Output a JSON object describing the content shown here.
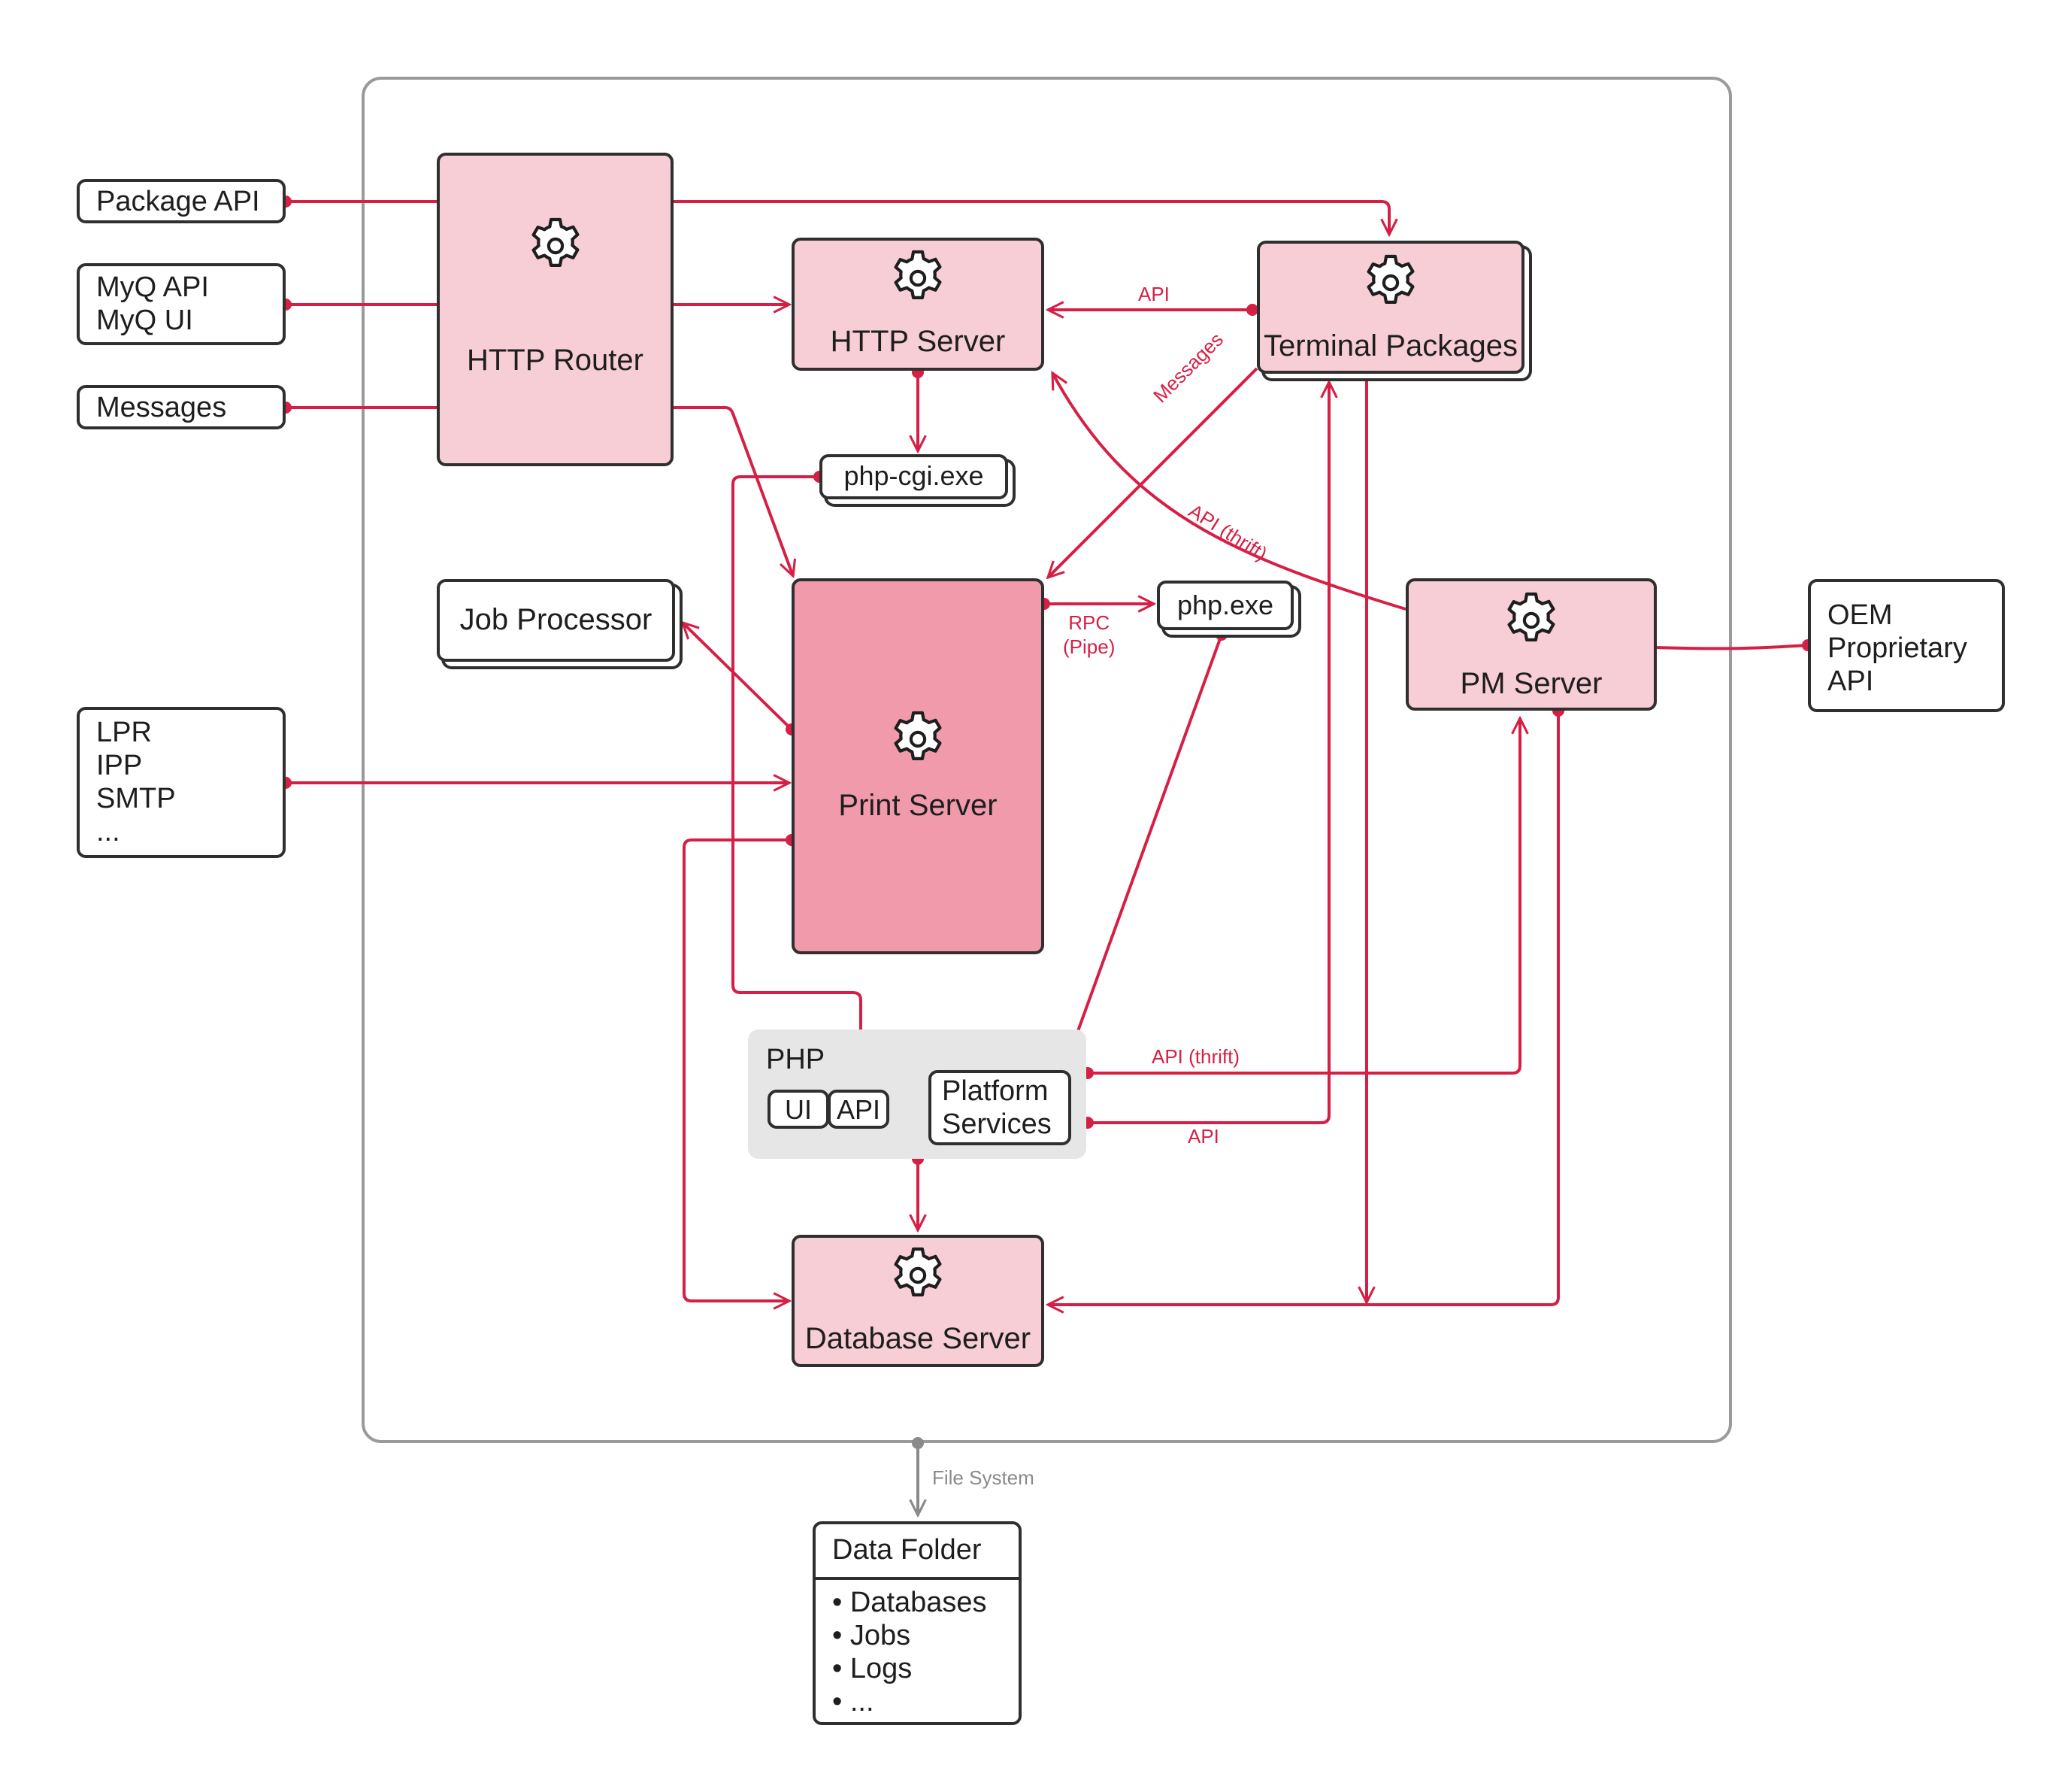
{
  "colors": {
    "edge": "#d61f45",
    "server_fill": "#f7cdd6",
    "print_server_fill": "#f09aab",
    "container_border": "#9a9a9a",
    "php_group_fill": "#e6e6e6"
  },
  "external": {
    "package_api": "Package API",
    "myq": "MyQ API\nMyQ UI",
    "messages": "Messages",
    "protocols": "LPR\nIPP\nSMTP\n...",
    "oem": "OEM\nProprietary\nAPI"
  },
  "components": {
    "http_router": "HTTP Router",
    "http_server": "HTTP Server",
    "terminal_packages": "Terminal Packages",
    "php_cgi": "php-cgi.exe",
    "job_processor": "Job Processor",
    "print_server": "Print Server",
    "php_exe": "php.exe",
    "pm_server": "PM Server",
    "database_server": "Database Server"
  },
  "php_group": {
    "title": "PHP",
    "ui": "UI",
    "api": "API",
    "platform_services": "Platform\nServices"
  },
  "edge_labels": {
    "api_terminal_http": "API",
    "messages": "Messages",
    "api_thrift_pm_http": "API (thrift)",
    "rpc_pipe": "RPC\n(Pipe)",
    "api_thrift_platform_pm": "API (thrift)",
    "api_platform_terminal": "API",
    "file_system": "File System"
  },
  "data_folder": {
    "title": "Data Folder",
    "items": [
      "• Databases",
      "• Jobs",
      "• Logs",
      "• ..."
    ]
  },
  "icons": {
    "gear": "gear-icon"
  }
}
